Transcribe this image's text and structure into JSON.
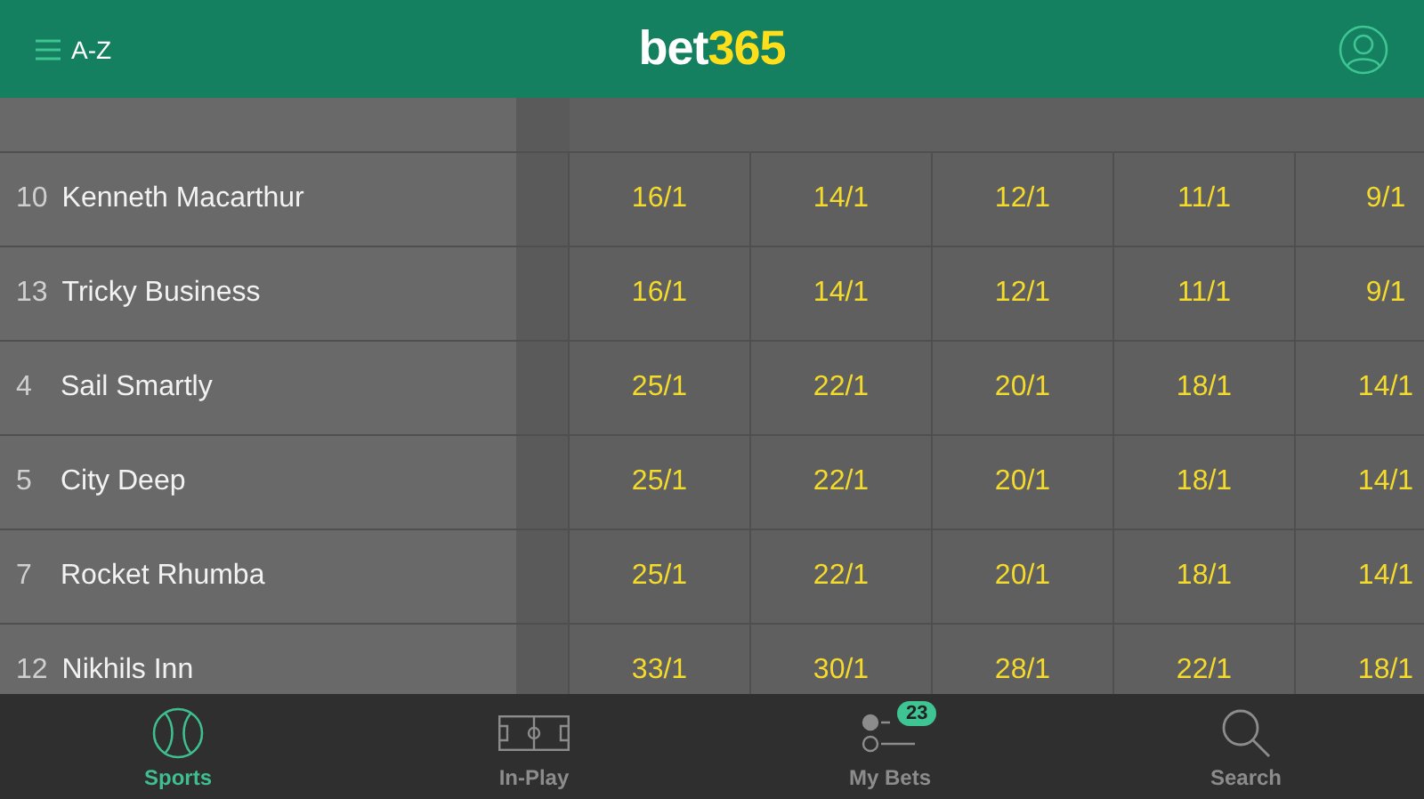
{
  "header": {
    "menu_label": "A-Z",
    "logo": {
      "part_1": "bet",
      "part_2": "365"
    }
  },
  "runners": [
    {
      "number": "10",
      "name": "Kenneth Macarthur",
      "odds": [
        "16/1",
        "14/1",
        "12/1",
        "11/1",
        "9/1"
      ]
    },
    {
      "number": "13",
      "name": "Tricky Business",
      "odds": [
        "16/1",
        "14/1",
        "12/1",
        "11/1",
        "9/1"
      ]
    },
    {
      "number": "4",
      "name": "Sail Smartly",
      "odds": [
        "25/1",
        "22/1",
        "20/1",
        "18/1",
        "14/1"
      ]
    },
    {
      "number": "5",
      "name": "City Deep",
      "odds": [
        "25/1",
        "22/1",
        "20/1",
        "18/1",
        "14/1"
      ]
    },
    {
      "number": "7",
      "name": "Rocket Rhumba",
      "odds": [
        "25/1",
        "22/1",
        "20/1",
        "18/1",
        "14/1"
      ]
    },
    {
      "number": "12",
      "name": "Nikhils Inn",
      "odds": [
        "33/1",
        "30/1",
        "28/1",
        "22/1",
        "18/1"
      ]
    }
  ],
  "bottom_nav": [
    {
      "kind": "sports",
      "label": "Sports",
      "selected": true
    },
    {
      "kind": "inplay",
      "label": "In-Play",
      "selected": false
    },
    {
      "kind": "mybets",
      "label": "My Bets",
      "selected": false,
      "badge": "23"
    },
    {
      "kind": "search",
      "label": "Search",
      "selected": false
    }
  ]
}
